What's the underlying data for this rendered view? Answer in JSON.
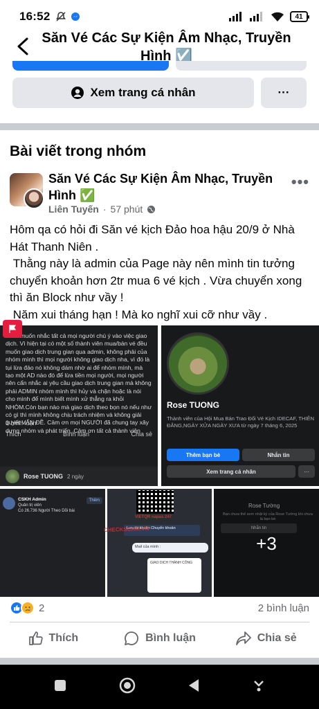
{
  "status_bar": {
    "time": "16:52",
    "battery": "41"
  },
  "header": {
    "title": "Săn Vé Các Sự Kiện Âm Nhạc, Truyền Hình ☑️"
  },
  "profile_actions": {
    "view_profile": "Xem trang cá nhân",
    "more": "···"
  },
  "section": {
    "title": "Bài viết trong nhóm"
  },
  "post": {
    "group_name": "Săn Vé Các Sự Kiện Âm Nhạc, Truyền Hình ✅",
    "author": "Liên Tuyến",
    "separator": "·",
    "time": "57 phút",
    "options": "•••",
    "body": "Hôm qa có hỏi đi Săn vé kịch Đảo hoa hậu 20/9 ở Nhà Hát Thanh Niên .\n Thằng này là admin của Page này nên mình tin tưởng chuyển khoản hơn 2tr mua 6 vé kịch . Vừa chuyển xong thì ăn Block như vầy !\n Năm xui tháng hạn ! Mà ko nghĩ xui cỡ như vầy ."
  },
  "images": {
    "chat_text": "Mình muốn nhắc tất cả mọi người chú ý vào việc giao dịch. Vì hiện tại có một số thành viên mua/bán vé đều muốn giao dịch trung gian qua admin, không phải của nhóm mình thì mọi người không giao dịch nha, vì đó là tụi lừa đảo nó không dám nhờ ai để nhóm mình, mà tạo một AD nào đó để lừa tiền mọi người, mọi người nên cẩn nhắc ai yêu cầu giao dịch trung gian mà không phải ADMIN nhóm mình thì hủy và chặn hoặc là nói cho mình để mình biết mình xử thẳng ra khỏi NHÓM.Còn bạn nào mà giao dịch theo bọn nó nếu như có gì thì mình không chịu trách nhiệm và không giải quyết VẤN ĐỀ. Cảm ơn mọi NGƯỜI đã chung tay xây dựng nhóm và phát triển. Cảm ơn tất cả thành viên",
    "chat_comments": "3 bình luận",
    "chat_like": "Thích",
    "chat_comment": "Bình luận",
    "chat_share": "Chia sẻ",
    "chat_author": "Rose TUONG",
    "chat_author_time": "2 ngày",
    "rose_name": "Rose TUONG",
    "rose_info": "Thành viên của Hội Mua Bán Trao Đổi Vé Kịch IDECAF, THIÊN ĐĂNG,NGÀY XỬA NGÀY XƯA từ ngày 7 tháng 6, 2025",
    "rose_add_friend": "Thêm bạn bè",
    "rose_message": "Nhắn tin",
    "rose_view_profile": "Xem trang cá nhân",
    "rose_more": "···",
    "cskh_name": "CSKH Admin",
    "cskh_role": "Quản trị viên",
    "cskh_detail": "Có 26.736 Người Theo Dõi bài",
    "cskh_button": "Thêm",
    "pay_brand": "VIETQR napas 247",
    "pay_list": "Lưu tài khoản     Chuyển khoản",
    "pay_mail": "Mail của mình :",
    "pay_card": "GIAO DỊCH THÀNH CÔNG",
    "watermark": "CHECKSCAM.VN",
    "dark_name": "Rose Tường",
    "dark_info": "Bạn chưa thể xem nhật ký của Rose Tường khi chưa là bạn bè",
    "dark_message": "Nhắn tin",
    "more_count": "+3"
  },
  "reactions": {
    "count": "2",
    "comments": "2 bình luận"
  },
  "actions": {
    "like": "Thích",
    "comment": "Bình luận",
    "share": "Chia sẻ"
  },
  "colors": {
    "brand": "#1877f2",
    "text": "#050505",
    "muted": "#65676b",
    "divider": "#c9ccd1"
  }
}
